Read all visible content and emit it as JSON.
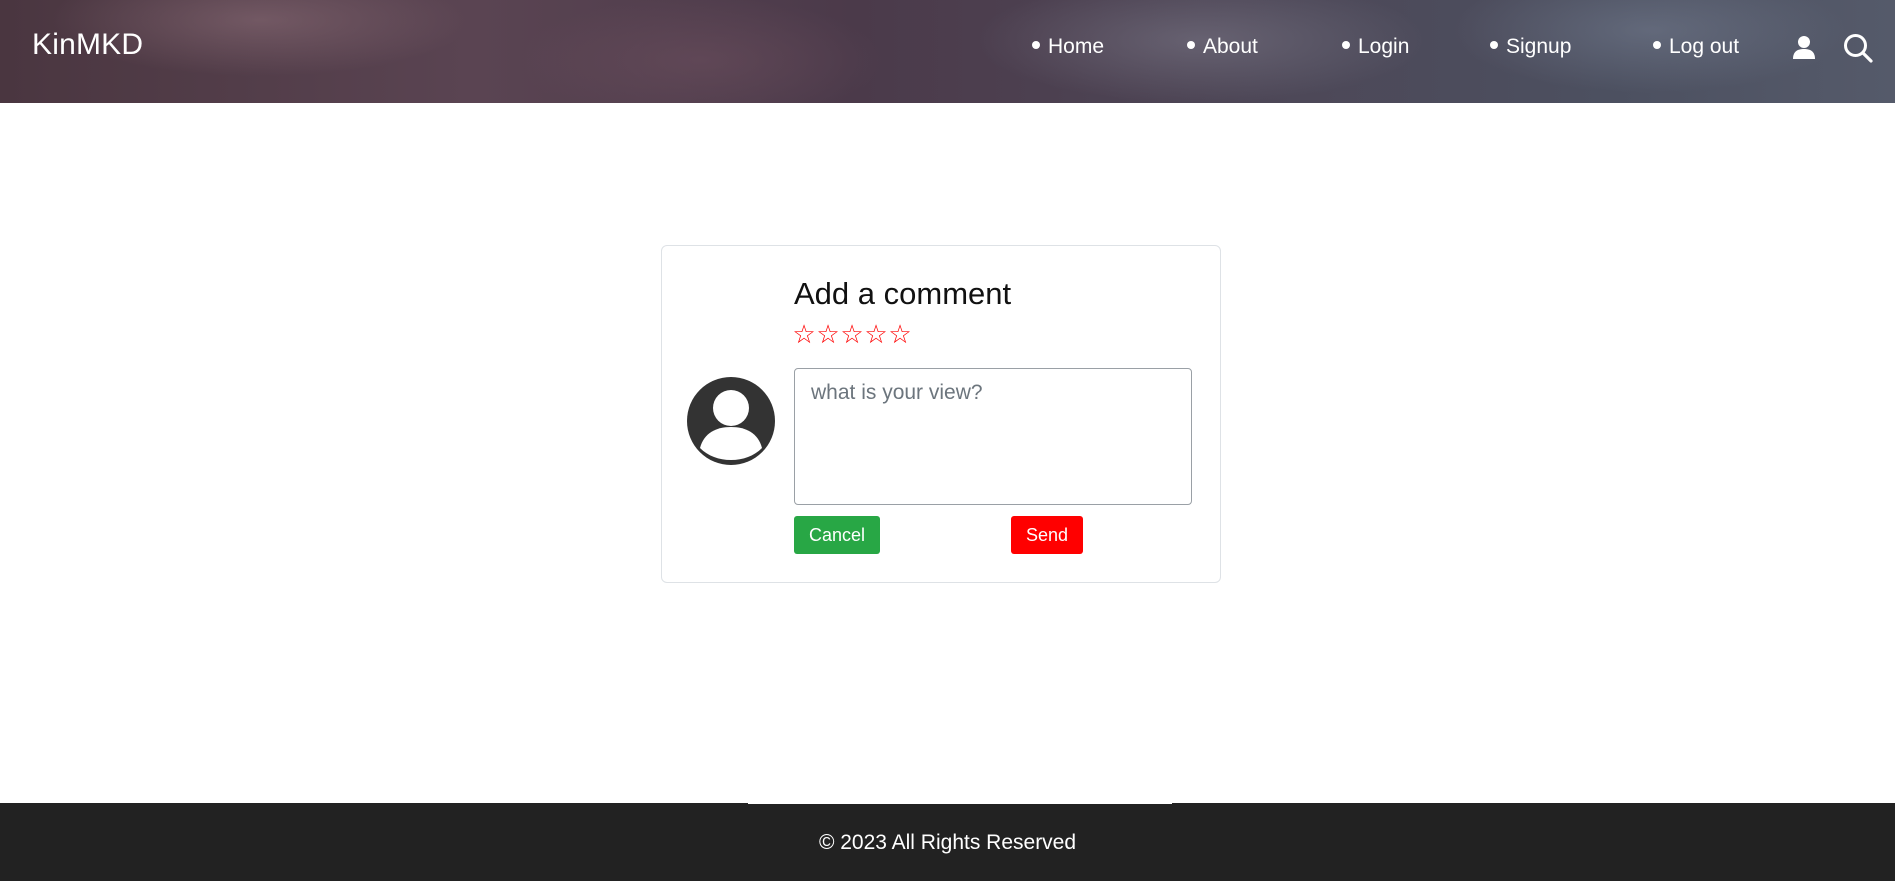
{
  "header": {
    "brand": "KinMKD",
    "nav": [
      {
        "label": "Home"
      },
      {
        "label": "About"
      },
      {
        "label": "Login"
      },
      {
        "label": "Signup"
      },
      {
        "label": "Log out"
      }
    ],
    "icons": [
      "user-icon",
      "search-icon"
    ]
  },
  "comment_card": {
    "title": "Add a comment",
    "rating": {
      "max": 5,
      "value": 0,
      "empty_star": "☆",
      "color": "#ff0000"
    },
    "textarea": {
      "placeholder": "what is your view?",
      "value": ""
    },
    "cancel_label": "Cancel",
    "send_label": "Send",
    "colors": {
      "cancel": "#28a745",
      "send": "#ff0000"
    }
  },
  "footer": {
    "copyright": "© 2023 All Rights Reserved"
  }
}
